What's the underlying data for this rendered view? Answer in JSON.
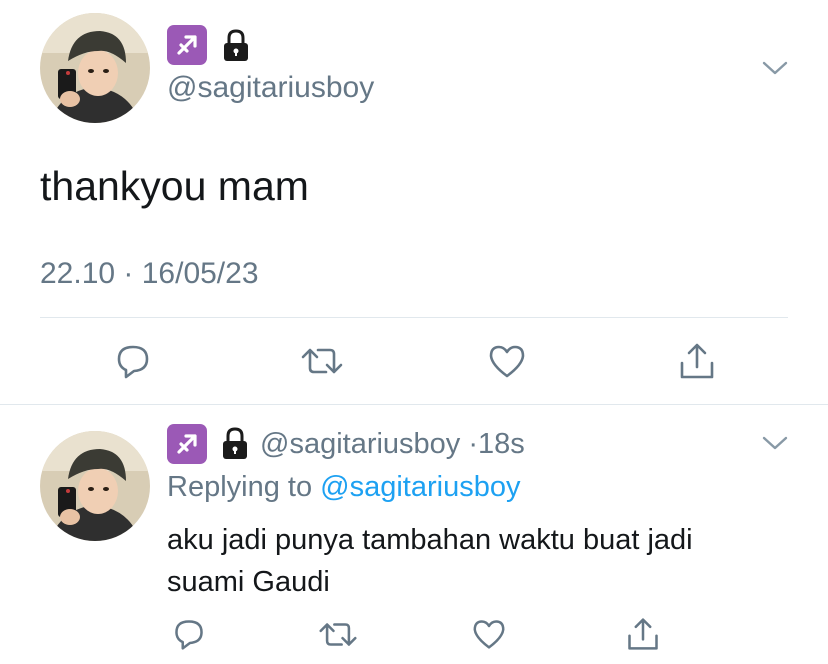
{
  "main_tweet": {
    "handle": "@sagitariusboy",
    "text": "thankyou mam",
    "timestamp": "22.10 · 16/05/23",
    "badge_icon": "sagittarius-icon",
    "lock_icon": "lock-icon"
  },
  "reply": {
    "handle": "@sagitariusboy",
    "age": "18s",
    "replying_prefix": "Replying to",
    "replying_to": "@sagitariusboy",
    "text_line1": "aku jadi punya tambahan waktu buat jadi",
    "text_line2": "suami Gaudi"
  },
  "actions": [
    "reply-icon",
    "retweet-icon",
    "like-icon",
    "share-icon"
  ],
  "colors": {
    "text": "#14171a",
    "muted": "#657786",
    "link": "#1da1f2",
    "badge": "#9b59b6",
    "divider": "#e1e8ed"
  }
}
